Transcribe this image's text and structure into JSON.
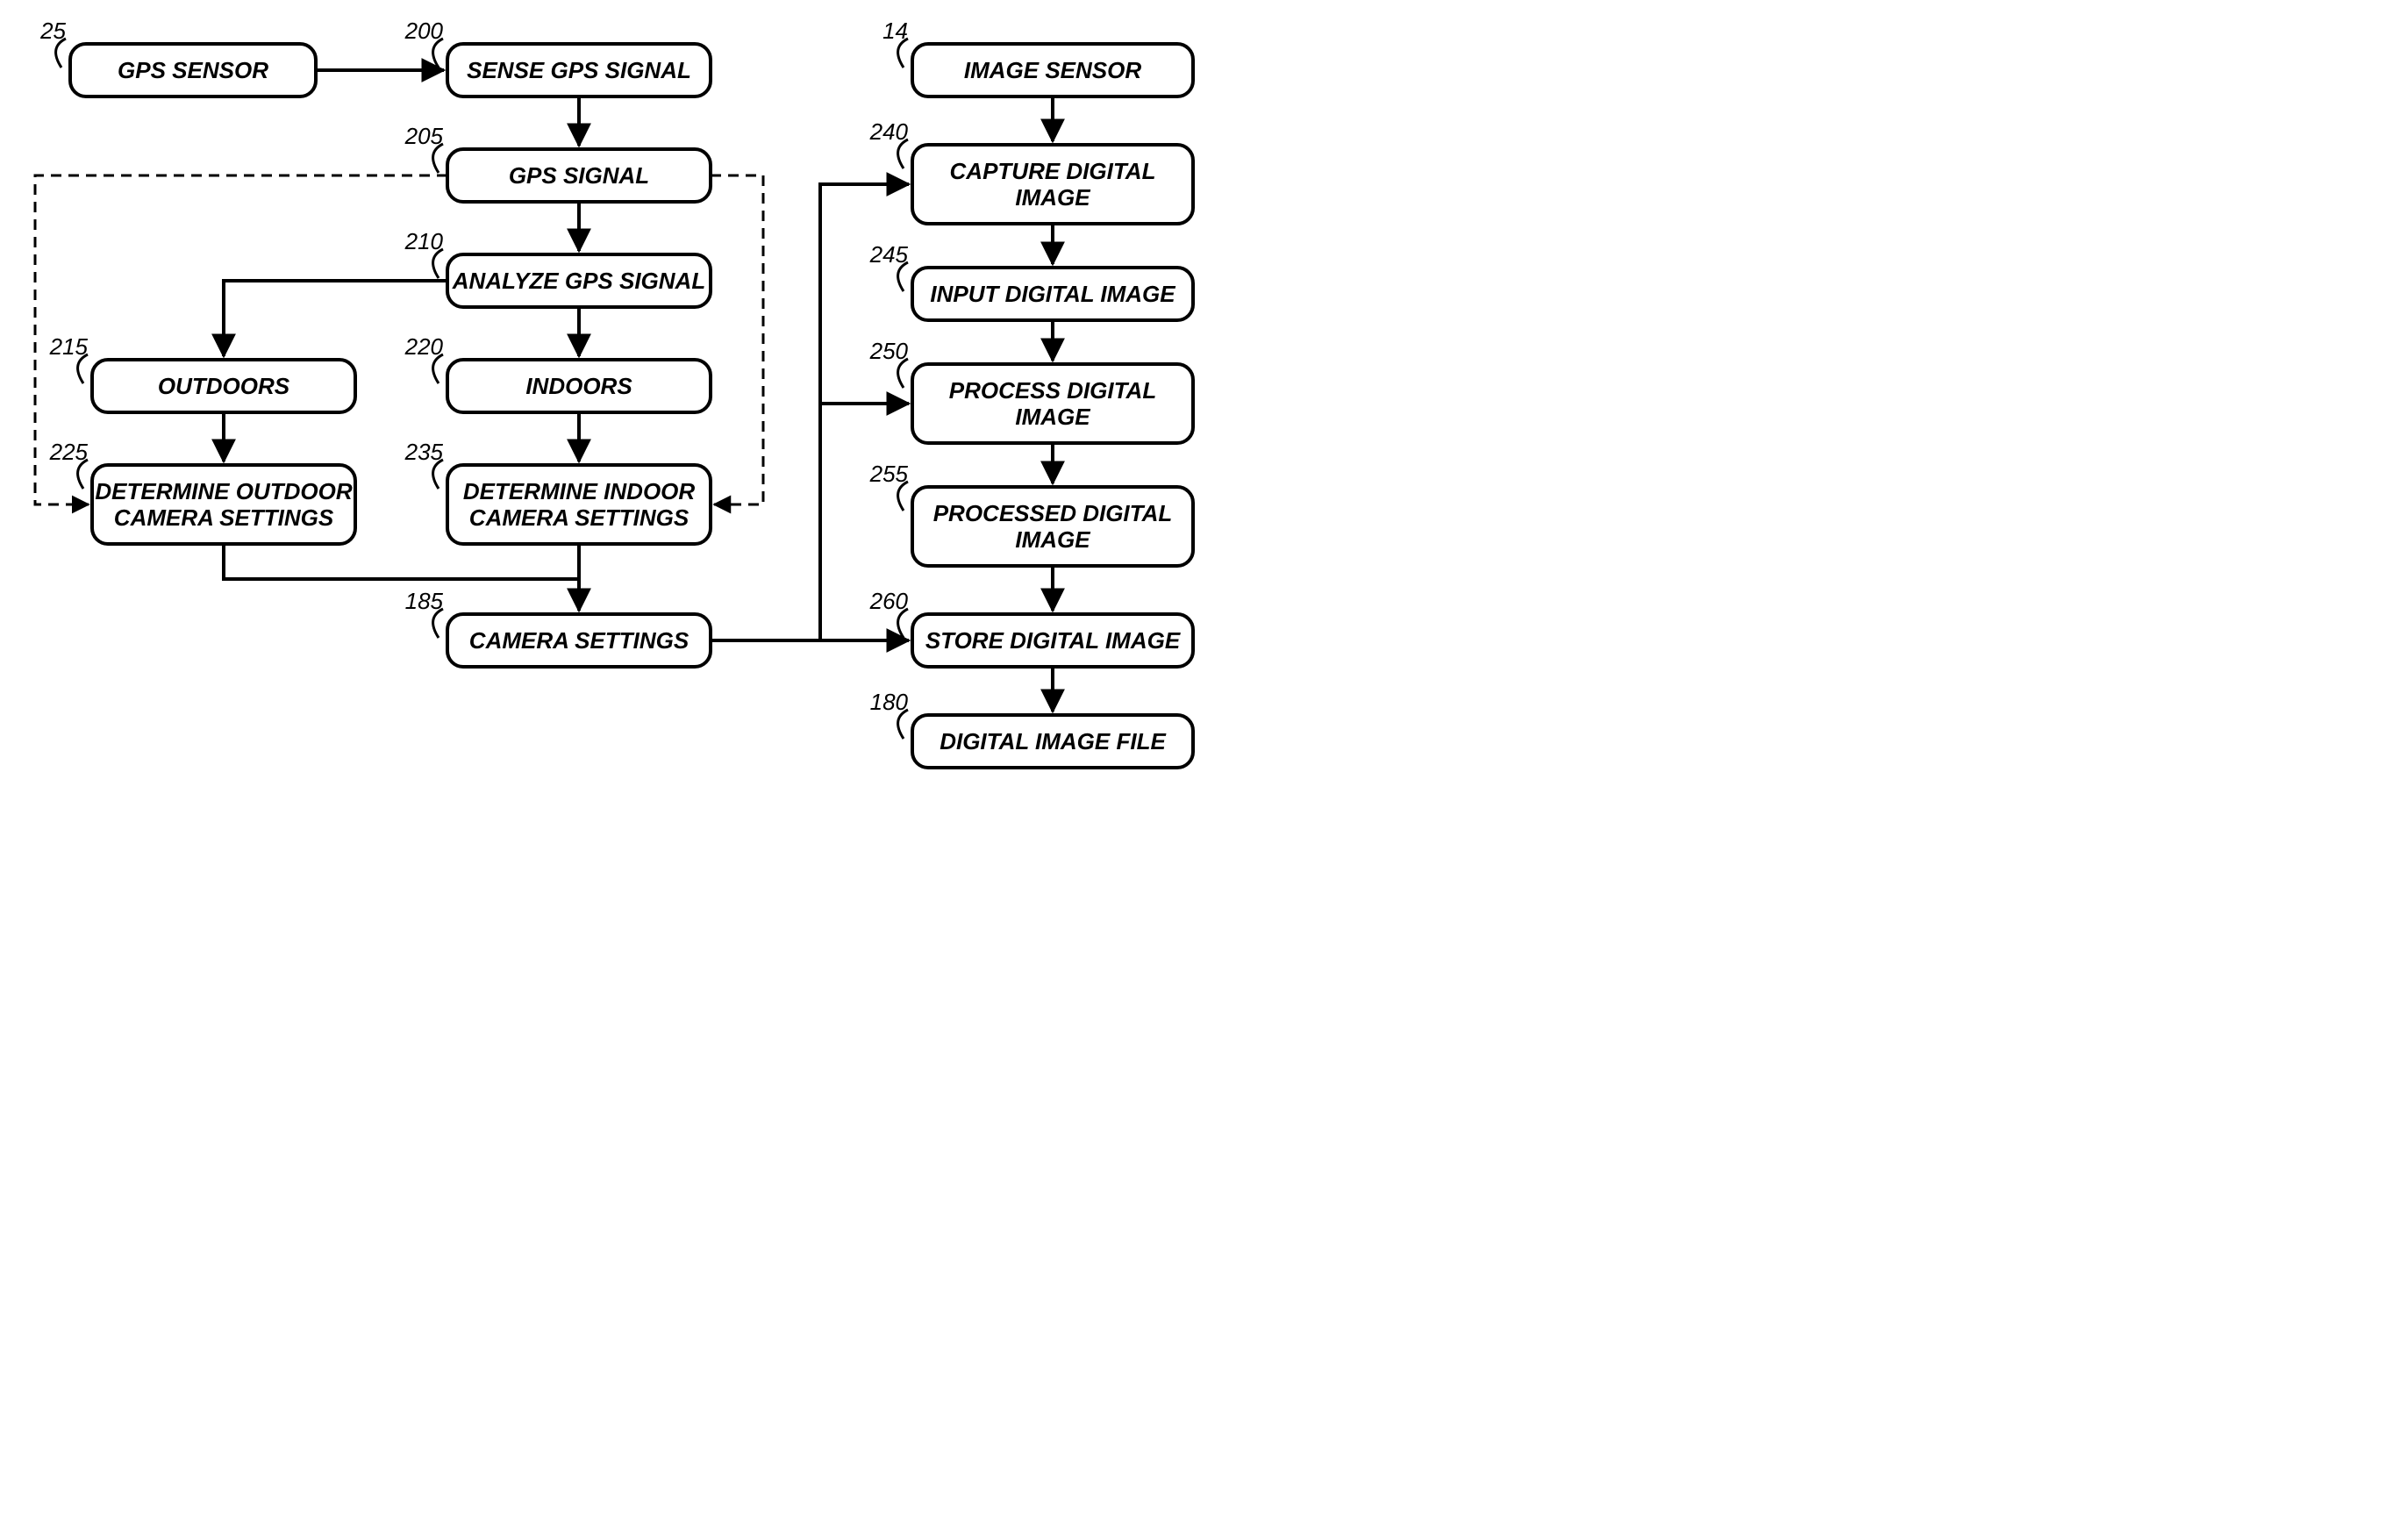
{
  "nodes": {
    "gps_sensor": {
      "ref": "25",
      "lines": [
        "GPS SENSOR"
      ]
    },
    "sense_gps": {
      "ref": "200",
      "lines": [
        "SENSE GPS SIGNAL"
      ]
    },
    "gps_signal": {
      "ref": "205",
      "lines": [
        "GPS SIGNAL"
      ]
    },
    "analyze": {
      "ref": "210",
      "lines": [
        "ANALYZE GPS SIGNAL"
      ]
    },
    "outdoors": {
      "ref": "215",
      "lines": [
        "OUTDOORS"
      ]
    },
    "indoors": {
      "ref": "220",
      "lines": [
        "INDOORS"
      ]
    },
    "det_outdoor": {
      "ref": "225",
      "lines": [
        "DETERMINE OUTDOOR",
        "CAMERA SETTINGS"
      ]
    },
    "det_indoor": {
      "ref": "235",
      "lines": [
        "DETERMINE INDOOR",
        "CAMERA SETTINGS"
      ]
    },
    "camera_settings": {
      "ref": "185",
      "lines": [
        "CAMERA SETTINGS"
      ]
    },
    "image_sensor": {
      "ref": "14",
      "lines": [
        "IMAGE SENSOR"
      ]
    },
    "capture": {
      "ref": "240",
      "lines": [
        "CAPTURE DIGITAL",
        "IMAGE"
      ]
    },
    "input_img": {
      "ref": "245",
      "lines": [
        "INPUT DIGITAL IMAGE"
      ]
    },
    "process": {
      "ref": "250",
      "lines": [
        "PROCESS DIGITAL",
        "IMAGE"
      ]
    },
    "processed": {
      "ref": "255",
      "lines": [
        "PROCESSED DIGITAL",
        "IMAGE"
      ]
    },
    "store": {
      "ref": "260",
      "lines": [
        "STORE DIGITAL IMAGE"
      ]
    },
    "file": {
      "ref": "180",
      "lines": [
        "DIGITAL IMAGE FILE"
      ]
    }
  }
}
